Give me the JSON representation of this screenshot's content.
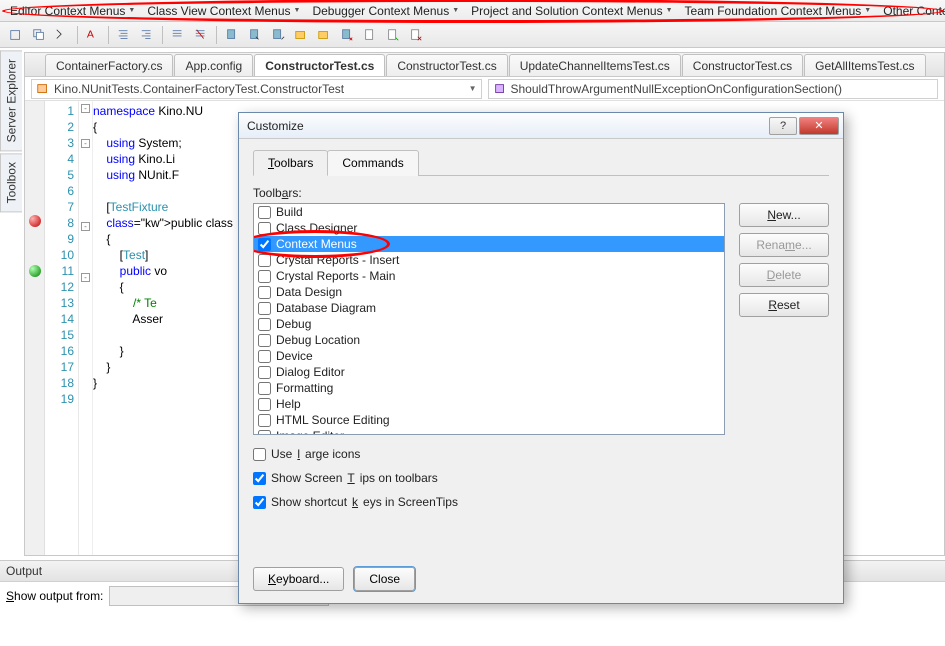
{
  "menubar": {
    "items": [
      "Editor Context Menus",
      "Class View Context Menus",
      "Debugger Context Menus",
      "Project and Solution Context Menus",
      "Team Foundation Context Menus",
      "Other Context Me"
    ]
  },
  "left_panels": {
    "server_explorer": "Server Explorer",
    "toolbox": "Toolbox"
  },
  "doc_tabs": [
    "ContainerFactory.cs",
    "App.config",
    "ConstructorTest.cs",
    "ConstructorTest.cs",
    "UpdateChannelItemsTest.cs",
    "ConstructorTest.cs",
    "GetAllItemsTest.cs"
  ],
  "active_tab_index": 2,
  "crumbs": {
    "left": "Kino.NUnitTests.ContainerFactoryTest.ConstructorTest",
    "right": "ShouldThrowArgumentNullExceptionOnConfigurationSection()"
  },
  "code_lines": [
    {
      "n": 1,
      "text": "namespace Kino.NU",
      "kw": [
        "namespace"
      ]
    },
    {
      "n": 2,
      "text": "{"
    },
    {
      "n": 3,
      "text": "    using System;",
      "kw": [
        "using"
      ]
    },
    {
      "n": 4,
      "text": "    using Kino.Li",
      "kw": [
        "using"
      ]
    },
    {
      "n": 5,
      "text": "    using NUnit.F",
      "kw": [
        "using"
      ]
    },
    {
      "n": 6,
      "text": ""
    },
    {
      "n": 7,
      "text": "    [TestFixture",
      "tp": [
        "TestFixture"
      ]
    },
    {
      "n": 8,
      "text": "    public class",
      "kw": [
        "public",
        "class"
      ]
    },
    {
      "n": 9,
      "text": "    {"
    },
    {
      "n": 10,
      "text": "        [Test]",
      "tp": [
        "Test"
      ]
    },
    {
      "n": 11,
      "text": "        public vo",
      "kw": [
        "public"
      ]
    },
    {
      "n": 12,
      "text": "        {"
    },
    {
      "n": 13,
      "text": "            /* Te",
      "cm": true
    },
    {
      "n": 14,
      "text": "            Asser"
    },
    {
      "n": 15,
      "text": ""
    },
    {
      "n": 16,
      "text": "        }"
    },
    {
      "n": 17,
      "text": "    }"
    },
    {
      "n": 18,
      "text": "}"
    },
    {
      "n": 19,
      "text": ""
    }
  ],
  "output": {
    "title": "Output",
    "label": "Show output from:"
  },
  "dialog": {
    "title": "Customize",
    "tabs": {
      "toolbars": "Toolbars",
      "commands": "Commands"
    },
    "toolbars_label": "Toolbars:",
    "toolbars_list": [
      {
        "label": "Build",
        "checked": false
      },
      {
        "label": "Class Designer",
        "checked": false
      },
      {
        "label": "Context Menus",
        "checked": true,
        "selected": true
      },
      {
        "label": "Crystal Reports - Insert",
        "checked": false
      },
      {
        "label": "Crystal Reports - Main",
        "checked": false
      },
      {
        "label": "Data Design",
        "checked": false
      },
      {
        "label": "Database Diagram",
        "checked": false
      },
      {
        "label": "Debug",
        "checked": false
      },
      {
        "label": "Debug Location",
        "checked": false
      },
      {
        "label": "Device",
        "checked": false
      },
      {
        "label": "Dialog Editor",
        "checked": false
      },
      {
        "label": "Formatting",
        "checked": false
      },
      {
        "label": "Help",
        "checked": false
      },
      {
        "label": "HTML Source Editing",
        "checked": false
      },
      {
        "label": "Image Editor",
        "checked": false
      }
    ],
    "buttons": {
      "new": "New...",
      "rename": "Rename...",
      "delete": "Delete",
      "reset": "Reset"
    },
    "opts": {
      "large_icons": "Use large icons",
      "screentips": "Show ScreenTips on toolbars",
      "shortcut_keys": "Show shortcut keys in ScreenTips"
    },
    "footer": {
      "keyboard": "Keyboard...",
      "close": "Close"
    }
  }
}
